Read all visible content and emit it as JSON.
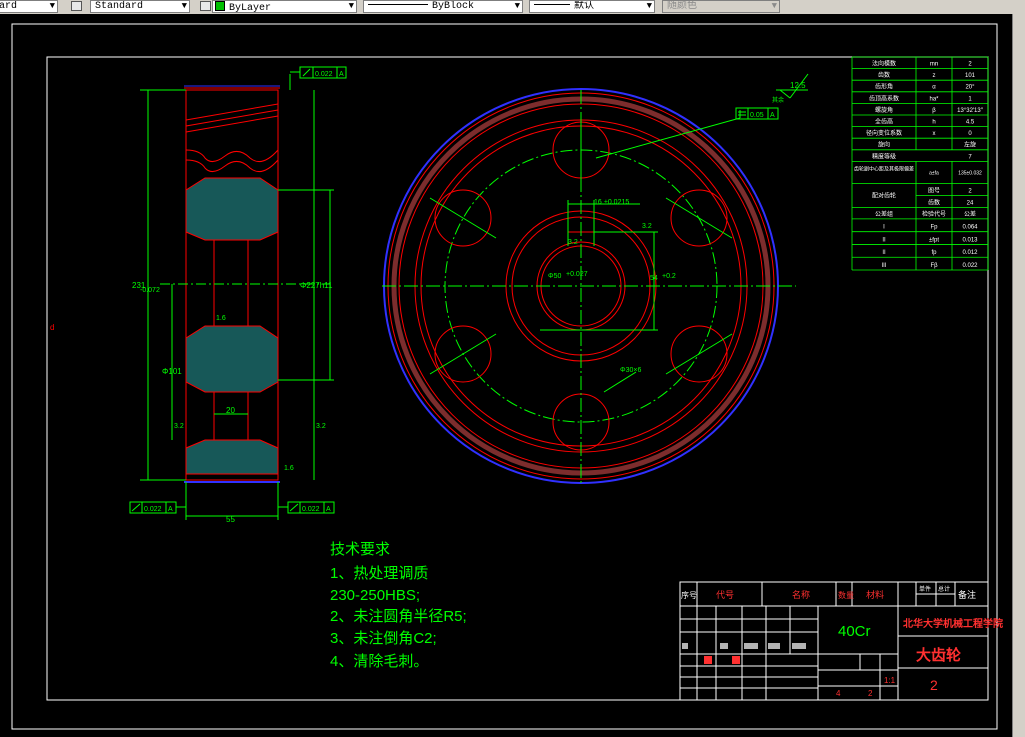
{
  "toolbar": {
    "textstyle_value": "ard",
    "dimstyle_value": "Standard",
    "layer_value": "ByLayer",
    "linetype_value": "ByBlock",
    "lineweight_value": "默认",
    "plotstyle_value": "随颜色"
  },
  "drawing": {
    "tolerance_frame_1": "0.022",
    "tolerance_frame_2": "0.05",
    "tolerance_frame_3": "0.022",
    "tolerance_frame_4": "0.022",
    "datum_A": "A",
    "roughness_value": "12.5",
    "roughness_other_label": "其余",
    "dim_tip_diameter": "Φ227h11",
    "dim_left_231": "231",
    "dim_left_072": "-0.072",
    "dim_width": "55",
    "dim_web": "20",
    "dim_bore_label": "Φ101",
    "dim_hub_hole": "Φ50",
    "dim_hub_tol": "+0.027",
    "dim_keyway_width": "16",
    "dim_keyway_tol": "±0.0215",
    "dim_keyway_depth": "54",
    "dim_keyway_depth_tol": "+0.2",
    "dim_holes": "Φ30×6",
    "ra_16a": "1.6",
    "ra_16b": "1.6",
    "ra_32a": "3.2",
    "ra_32b": "3.2",
    "ra_32c": "3.2",
    "ra_32d": "3.2",
    "ra_32e": "3.2",
    "stray_d": "d"
  },
  "params_table": {
    "rows": [
      [
        "法向模数",
        "mn",
        "2"
      ],
      [
        "齿数",
        "z",
        "101"
      ],
      [
        "齿形角",
        "α",
        "20°"
      ],
      [
        "齿顶高系数",
        "ha*",
        "1"
      ],
      [
        "螺旋角",
        "β",
        "13°32′13″"
      ],
      [
        "全齿高",
        "h",
        "4.5"
      ],
      [
        "径向变位系数",
        "x",
        "0"
      ],
      [
        "旋向",
        "",
        "左旋"
      ],
      [
        "精度等级",
        "",
        "7"
      ]
    ],
    "center_distance_label": "齿轮副中心距及其极限偏差",
    "center_distance_sym": "a±fa",
    "center_distance_val": "135±0.032",
    "mating_label": "配对齿轮",
    "mating_rows": [
      [
        "图号",
        "2"
      ],
      [
        "齿数",
        "24"
      ]
    ],
    "tolerance_header": [
      "公差组",
      "检验代号",
      "公差"
    ],
    "tolerance_rows": [
      [
        "I",
        "Fp",
        "0.064"
      ],
      [
        "II",
        "±fpt",
        "0.013"
      ],
      [
        "II",
        "fp",
        "0.012"
      ],
      [
        "III",
        "Fβ",
        "0.022"
      ]
    ]
  },
  "tech_req": {
    "title": "技术要求",
    "lines": [
      "1、热处理调质",
      "230-250HBS;",
      "2、未注圆角半径R5;",
      "3、未注倒角C2;",
      "4、清除毛刺。"
    ]
  },
  "title_block": {
    "headers": [
      "序号",
      "代号",
      "名称",
      "数量",
      "材料",
      "备注"
    ],
    "header_extra": [
      "单件",
      "总计"
    ],
    "material": "40Cr",
    "school": "北华大学机械工程学院",
    "part_name": "大齿轮",
    "drawing_no": "2",
    "scale": "1:1",
    "sheet_4": "4",
    "sheet_2": "2"
  }
}
